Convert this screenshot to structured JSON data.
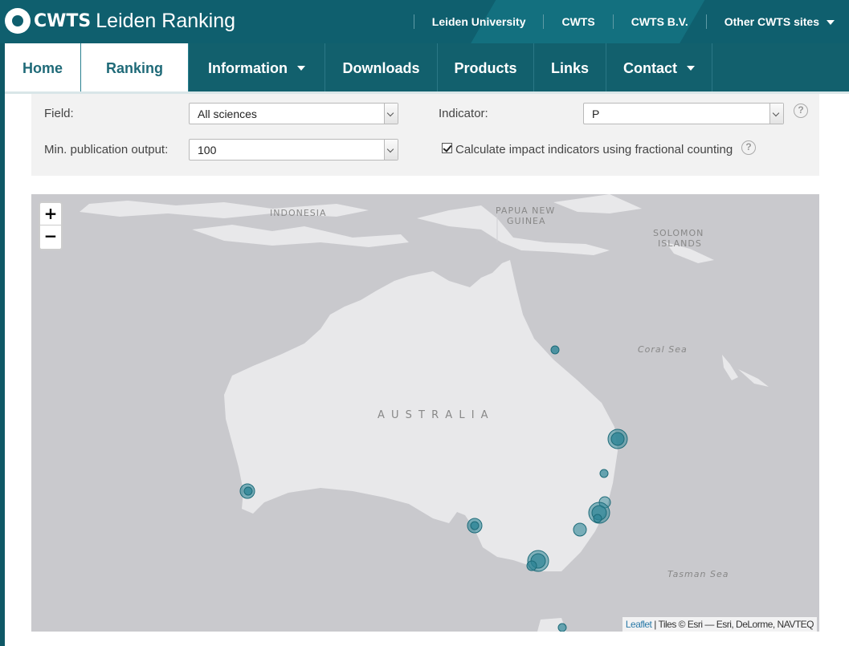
{
  "header": {
    "brand": "CWTS",
    "product": "Leiden Ranking",
    "links": [
      {
        "label": "Leiden University"
      },
      {
        "label": "CWTS"
      },
      {
        "label": "CWTS B.V."
      },
      {
        "label": "Other CWTS sites"
      }
    ]
  },
  "nav": {
    "items": [
      {
        "label": "Home"
      },
      {
        "label": "Ranking"
      },
      {
        "label": "Information"
      },
      {
        "label": "Downloads"
      },
      {
        "label": "Products"
      },
      {
        "label": "Links"
      },
      {
        "label": "Contact"
      }
    ]
  },
  "filters": {
    "field_label": "Field:",
    "field_value": "All sciences",
    "indicator_label": "Indicator:",
    "indicator_value": "P",
    "min_output_label": "Min. publication output:",
    "min_output_value": "100",
    "fractional_label": "Calculate impact indicators using fractional counting",
    "fractional_checked": true,
    "help_symbol": "?"
  },
  "map": {
    "zoom_in": "+",
    "zoom_out": "−",
    "labels": {
      "indonesia": "INDONESIA",
      "papua_1": "PAPUA NEW",
      "papua_2": "GUINEA",
      "solomon_1": "SOLOMON",
      "solomon_2": "ISLANDS",
      "coral_sea": "Coral Sea",
      "australia": "A U S T R A L I A",
      "tasman_sea": "Tasman Sea"
    },
    "attribution": {
      "leaflet": "Leaflet",
      "tiles": " | Tiles © Esri — Esri, DeLorme, NAVTEQ"
    },
    "marker_color": "#2d8596"
  }
}
